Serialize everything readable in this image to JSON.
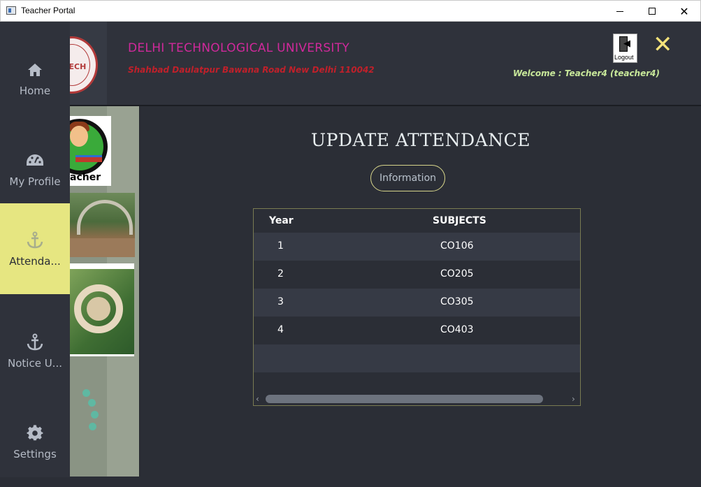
{
  "window": {
    "title": "Teacher Portal",
    "minimize_icon": "minimize-icon",
    "maximize_icon": "maximize-icon",
    "close_glyph": "✕"
  },
  "header": {
    "university_name": "DELHI TECHNOLOGICAL UNIVERSITY",
    "address": "Shahbad Daulatpur Bawana Road New Delhi 110042",
    "welcome": "Welcome : Teacher4 (teacher4)",
    "logout_label": "Logout",
    "close_glyph": "✕",
    "seal_text": "TECH",
    "colors": {
      "university_name": "#d0299b",
      "address": "#c0202a",
      "welcome": "#c8e89a",
      "close": "#f4e27a"
    }
  },
  "sidebar": {
    "items": [
      {
        "label": "Home",
        "icon": "home-icon",
        "active": false
      },
      {
        "label": "My Profile",
        "icon": "dashboard-icon",
        "active": false
      },
      {
        "label": "Attenda...",
        "icon": "anchor-icon",
        "active": true
      },
      {
        "label": "Notice U...",
        "icon": "anchor-icon",
        "active": false
      },
      {
        "label": "Settings",
        "icon": "gear-icon",
        "active": false
      }
    ],
    "active_color": "#e6e681"
  },
  "image_panel": {
    "teacher_caption": "acher"
  },
  "main": {
    "title": "UPDATE ATTENDANCE",
    "info_button": "Information",
    "table": {
      "columns": [
        "Year",
        "SUBJECTS"
      ],
      "rows": [
        {
          "year": "1",
          "subject": "CO106"
        },
        {
          "year": "2",
          "subject": "CO205"
        },
        {
          "year": "3",
          "subject": "CO305"
        },
        {
          "year": "4",
          "subject": "CO403"
        }
      ],
      "scroll_left_glyph": "‹",
      "scroll_right_glyph": "›"
    }
  }
}
